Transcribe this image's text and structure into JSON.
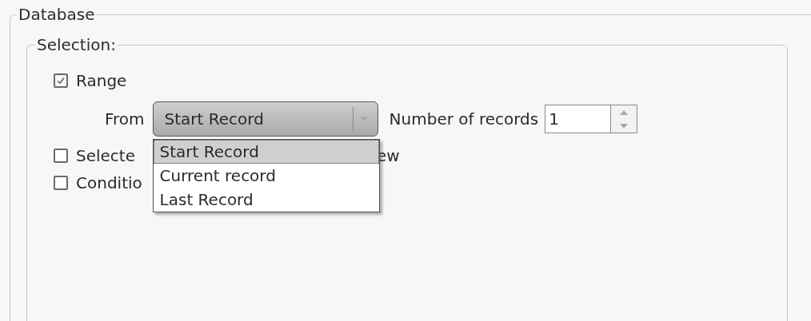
{
  "group": {
    "title": "Database"
  },
  "selection": {
    "title": "Selection:"
  },
  "options": [
    {
      "kind": "range",
      "label": "Range",
      "checked": true
    },
    {
      "kind": "covered",
      "label": "Selecte",
      "tail": "ew",
      "checked": false
    },
    {
      "kind": "covered",
      "label": "Conditio",
      "checked": false
    }
  ],
  "from": {
    "label": "From",
    "value": "Start Record",
    "expanded": true,
    "items": [
      {
        "label": "Start Record",
        "selected": true
      },
      {
        "label": "Current record",
        "selected": false
      },
      {
        "label": "Last Record",
        "selected": false
      }
    ]
  },
  "count": {
    "label": "Number of records",
    "value": "1"
  }
}
